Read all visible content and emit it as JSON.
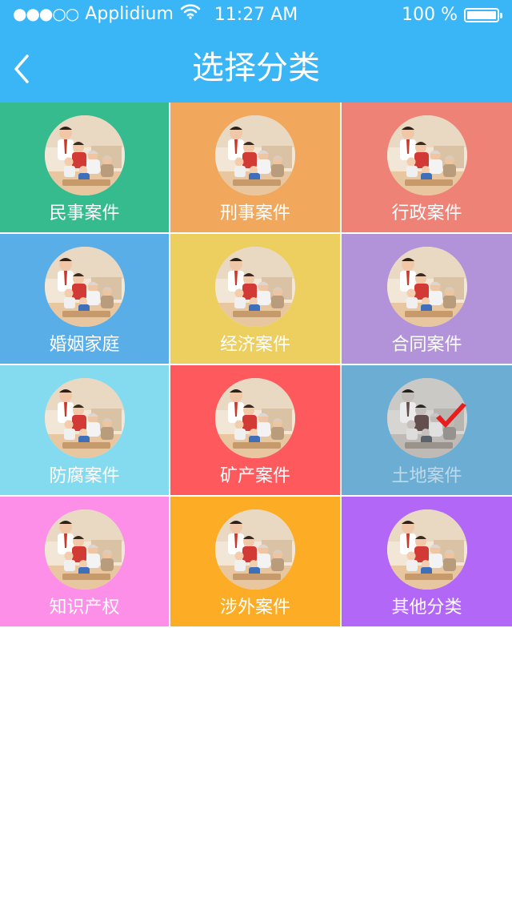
{
  "status_bar": {
    "signal": "●●●○○",
    "carrier": "Applidium",
    "time": "11:27 AM",
    "battery_text": "100 %",
    "battery_level": 1.0
  },
  "nav": {
    "title": "选择分类"
  },
  "colors": {
    "header": "#3ab6f7"
  },
  "categories": [
    {
      "label": "民事案件",
      "color": "#36bb8f",
      "selected": false
    },
    {
      "label": "刑事案件",
      "color": "#f1a85c",
      "selected": false
    },
    {
      "label": "行政案件",
      "color": "#ef8276",
      "selected": false
    },
    {
      "label": "婚姻家庭",
      "color": "#5aaee8",
      "selected": false
    },
    {
      "label": "经济案件",
      "color": "#eccf5f",
      "selected": false
    },
    {
      "label": "合同案件",
      "color": "#b292d8",
      "selected": false
    },
    {
      "label": "防腐案件",
      "color": "#84dbef",
      "selected": false
    },
    {
      "label": "矿产案件",
      "color": "#fe5a5e",
      "selected": false
    },
    {
      "label": "土地案件",
      "color": "#6cadd4",
      "selected": true
    },
    {
      "label": "知识产权",
      "color": "#fd8fe8",
      "selected": false
    },
    {
      "label": "涉外案件",
      "color": "#fdad25",
      "selected": false
    },
    {
      "label": "其他分类",
      "color": "#b267f7",
      "selected": false
    }
  ]
}
